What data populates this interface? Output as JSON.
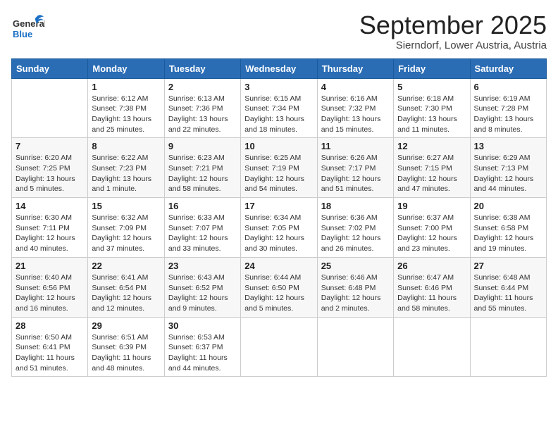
{
  "logo": {
    "general": "General",
    "blue": "Blue"
  },
  "header": {
    "month": "September 2025",
    "location": "Sierndorf, Lower Austria, Austria"
  },
  "weekdays": [
    "Sunday",
    "Monday",
    "Tuesday",
    "Wednesday",
    "Thursday",
    "Friday",
    "Saturday"
  ],
  "weeks": [
    [
      {
        "day": "",
        "info": ""
      },
      {
        "day": "1",
        "info": "Sunrise: 6:12 AM\nSunset: 7:38 PM\nDaylight: 13 hours\nand 25 minutes."
      },
      {
        "day": "2",
        "info": "Sunrise: 6:13 AM\nSunset: 7:36 PM\nDaylight: 13 hours\nand 22 minutes."
      },
      {
        "day": "3",
        "info": "Sunrise: 6:15 AM\nSunset: 7:34 PM\nDaylight: 13 hours\nand 18 minutes."
      },
      {
        "day": "4",
        "info": "Sunrise: 6:16 AM\nSunset: 7:32 PM\nDaylight: 13 hours\nand 15 minutes."
      },
      {
        "day": "5",
        "info": "Sunrise: 6:18 AM\nSunset: 7:30 PM\nDaylight: 13 hours\nand 11 minutes."
      },
      {
        "day": "6",
        "info": "Sunrise: 6:19 AM\nSunset: 7:28 PM\nDaylight: 13 hours\nand 8 minutes."
      }
    ],
    [
      {
        "day": "7",
        "info": "Sunrise: 6:20 AM\nSunset: 7:25 PM\nDaylight: 13 hours\nand 5 minutes."
      },
      {
        "day": "8",
        "info": "Sunrise: 6:22 AM\nSunset: 7:23 PM\nDaylight: 13 hours\nand 1 minute."
      },
      {
        "day": "9",
        "info": "Sunrise: 6:23 AM\nSunset: 7:21 PM\nDaylight: 12 hours\nand 58 minutes."
      },
      {
        "day": "10",
        "info": "Sunrise: 6:25 AM\nSunset: 7:19 PM\nDaylight: 12 hours\nand 54 minutes."
      },
      {
        "day": "11",
        "info": "Sunrise: 6:26 AM\nSunset: 7:17 PM\nDaylight: 12 hours\nand 51 minutes."
      },
      {
        "day": "12",
        "info": "Sunrise: 6:27 AM\nSunset: 7:15 PM\nDaylight: 12 hours\nand 47 minutes."
      },
      {
        "day": "13",
        "info": "Sunrise: 6:29 AM\nSunset: 7:13 PM\nDaylight: 12 hours\nand 44 minutes."
      }
    ],
    [
      {
        "day": "14",
        "info": "Sunrise: 6:30 AM\nSunset: 7:11 PM\nDaylight: 12 hours\nand 40 minutes."
      },
      {
        "day": "15",
        "info": "Sunrise: 6:32 AM\nSunset: 7:09 PM\nDaylight: 12 hours\nand 37 minutes."
      },
      {
        "day": "16",
        "info": "Sunrise: 6:33 AM\nSunset: 7:07 PM\nDaylight: 12 hours\nand 33 minutes."
      },
      {
        "day": "17",
        "info": "Sunrise: 6:34 AM\nSunset: 7:05 PM\nDaylight: 12 hours\nand 30 minutes."
      },
      {
        "day": "18",
        "info": "Sunrise: 6:36 AM\nSunset: 7:02 PM\nDaylight: 12 hours\nand 26 minutes."
      },
      {
        "day": "19",
        "info": "Sunrise: 6:37 AM\nSunset: 7:00 PM\nDaylight: 12 hours\nand 23 minutes."
      },
      {
        "day": "20",
        "info": "Sunrise: 6:38 AM\nSunset: 6:58 PM\nDaylight: 12 hours\nand 19 minutes."
      }
    ],
    [
      {
        "day": "21",
        "info": "Sunrise: 6:40 AM\nSunset: 6:56 PM\nDaylight: 12 hours\nand 16 minutes."
      },
      {
        "day": "22",
        "info": "Sunrise: 6:41 AM\nSunset: 6:54 PM\nDaylight: 12 hours\nand 12 minutes."
      },
      {
        "day": "23",
        "info": "Sunrise: 6:43 AM\nSunset: 6:52 PM\nDaylight: 12 hours\nand 9 minutes."
      },
      {
        "day": "24",
        "info": "Sunrise: 6:44 AM\nSunset: 6:50 PM\nDaylight: 12 hours\nand 5 minutes."
      },
      {
        "day": "25",
        "info": "Sunrise: 6:46 AM\nSunset: 6:48 PM\nDaylight: 12 hours\nand 2 minutes."
      },
      {
        "day": "26",
        "info": "Sunrise: 6:47 AM\nSunset: 6:46 PM\nDaylight: 11 hours\nand 58 minutes."
      },
      {
        "day": "27",
        "info": "Sunrise: 6:48 AM\nSunset: 6:44 PM\nDaylight: 11 hours\nand 55 minutes."
      }
    ],
    [
      {
        "day": "28",
        "info": "Sunrise: 6:50 AM\nSunset: 6:41 PM\nDaylight: 11 hours\nand 51 minutes."
      },
      {
        "day": "29",
        "info": "Sunrise: 6:51 AM\nSunset: 6:39 PM\nDaylight: 11 hours\nand 48 minutes."
      },
      {
        "day": "30",
        "info": "Sunrise: 6:53 AM\nSunset: 6:37 PM\nDaylight: 11 hours\nand 44 minutes."
      },
      {
        "day": "",
        "info": ""
      },
      {
        "day": "",
        "info": ""
      },
      {
        "day": "",
        "info": ""
      },
      {
        "day": "",
        "info": ""
      }
    ]
  ]
}
